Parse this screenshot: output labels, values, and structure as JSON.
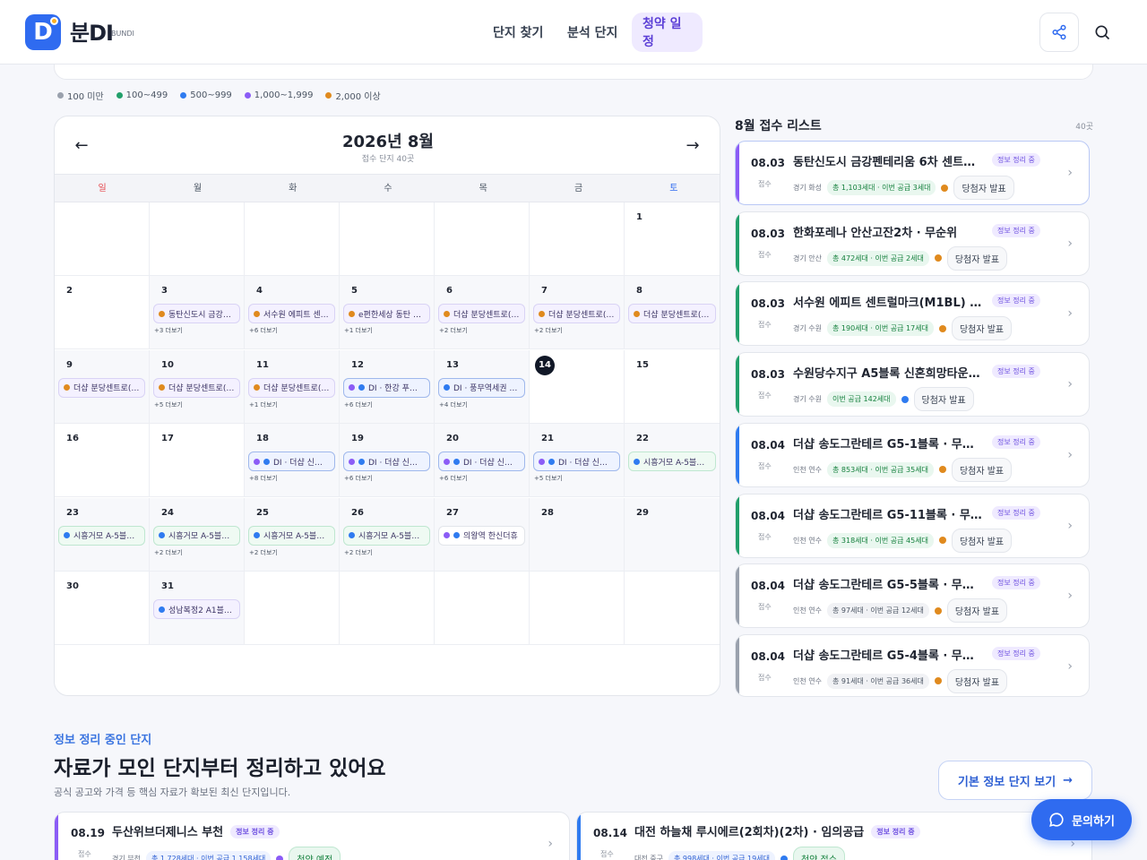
{
  "brand": {
    "name": "분DI",
    "sub": "BUNDI"
  },
  "nav": [
    {
      "label": "단지 찾기"
    },
    {
      "label": "분석 단지"
    },
    {
      "label": "청약 일정",
      "active": true
    }
  ],
  "legend": [
    {
      "label": "100 미만",
      "color": "#9aa1ad"
    },
    {
      "label": "100~499",
      "color": "#22a06b"
    },
    {
      "label": "500~999",
      "color": "#2f7bf0"
    },
    {
      "label": "1,000~1,999",
      "color": "#8b5cf6"
    },
    {
      "label": "2,000 이상",
      "color": "#e08a1e"
    }
  ],
  "calendar": {
    "title": "2026년 8월",
    "subtitle": "접수 단지 40곳",
    "weekdays": [
      "일",
      "월",
      "화",
      "수",
      "목",
      "금",
      "토"
    ],
    "cells": [
      {
        "day": "",
        "dim": false
      },
      {
        "day": "",
        "dim": false
      },
      {
        "day": "",
        "dim": false
      },
      {
        "day": "",
        "dim": false
      },
      {
        "day": "",
        "dim": false
      },
      {
        "day": "",
        "dim": false
      },
      {
        "day": "1",
        "dim": false
      },
      {
        "day": "2",
        "dim": false
      },
      {
        "day": "3",
        "dim": true,
        "ev": "동탄신도시 금강…",
        "cls": "",
        "dots": [
          "#e08a1e"
        ],
        "more": "+3 더보기"
      },
      {
        "day": "4",
        "dim": true,
        "ev": "서수원 에피트 센…",
        "cls": "",
        "dots": [
          "#e08a1e"
        ],
        "more": "+6 더보기"
      },
      {
        "day": "5",
        "dim": true,
        "ev": "e편한세상 동탄 …",
        "cls": "",
        "dots": [
          "#e08a1e"
        ],
        "more": "+1 더보기"
      },
      {
        "day": "6",
        "dim": true,
        "ev": "더샵 분당센트로(…",
        "cls": "",
        "dots": [
          "#e08a1e"
        ],
        "more": "+2 더보기"
      },
      {
        "day": "7",
        "dim": true,
        "ev": "더샵 분당센트로(…",
        "cls": "",
        "dots": [
          "#e08a1e"
        ],
        "more": "+2 더보기"
      },
      {
        "day": "8",
        "dim": true,
        "ev": "더샵 분당센트로(…",
        "cls": "",
        "dots": [
          "#e08a1e"
        ]
      },
      {
        "day": "9",
        "dim": true,
        "ev": "더샵 분당센트로(…",
        "cls": "",
        "dots": [
          "#e08a1e"
        ]
      },
      {
        "day": "10",
        "dim": true,
        "ev": "더샵 분당센트로(…",
        "cls": "",
        "dots": [
          "#e08a1e"
        ],
        "more": "+5 더보기"
      },
      {
        "day": "11",
        "dim": true,
        "ev": "더샵 분당센트로(…",
        "cls": "",
        "dots": [
          "#e08a1e"
        ],
        "more": "+1 더보기"
      },
      {
        "day": "12",
        "dim": true,
        "ev": "DI · 한강 푸르…",
        "cls": "blue",
        "dots": [
          "#8b5cf6",
          "#2f7bf0"
        ],
        "more": "+6 더보기"
      },
      {
        "day": "13",
        "dim": true,
        "ev": "DI · 풍무역세권 …",
        "cls": "blue",
        "dots": [
          "#2f7bf0"
        ],
        "more": "+4 더보기"
      },
      {
        "day": "14",
        "dim": false,
        "today": true
      },
      {
        "day": "15",
        "dim": false
      },
      {
        "day": "16",
        "dim": false
      },
      {
        "day": "17",
        "dim": false
      },
      {
        "day": "18",
        "dim": true,
        "ev": "DI · 더샵 신길…",
        "cls": "blue",
        "dots": [
          "#8b5cf6",
          "#2f7bf0"
        ],
        "more": "+8 더보기"
      },
      {
        "day": "19",
        "dim": true,
        "ev": "DI · 더샵 신길…",
        "cls": "blue",
        "dots": [
          "#8b5cf6",
          "#2f7bf0"
        ],
        "more": "+6 더보기"
      },
      {
        "day": "20",
        "dim": true,
        "ev": "DI · 더샵 신길…",
        "cls": "blue",
        "dots": [
          "#8b5cf6",
          "#2f7bf0"
        ],
        "more": "+6 더보기"
      },
      {
        "day": "21",
        "dim": true,
        "ev": "DI · 더샵 신길…",
        "cls": "blue",
        "dots": [
          "#8b5cf6",
          "#2f7bf0"
        ],
        "more": "+5 더보기"
      },
      {
        "day": "22",
        "dim": true,
        "ev": "시흥거모 A-5블…",
        "cls": "green",
        "dots": [
          "#2f7bf0"
        ]
      },
      {
        "day": "23",
        "dim": true,
        "ev": "시흥거모 A-5블…",
        "cls": "green",
        "dots": [
          "#2f7bf0"
        ]
      },
      {
        "day": "24",
        "dim": true,
        "ev": "시흥거모 A-5블…",
        "cls": "green",
        "dots": [
          "#2f7bf0"
        ],
        "more": "+2 더보기"
      },
      {
        "day": "25",
        "dim": true,
        "ev": "시흥거모 A-5블…",
        "cls": "green",
        "dots": [
          "#2f7bf0"
        ],
        "more": "+2 더보기"
      },
      {
        "day": "26",
        "dim": true,
        "ev": "시흥거모 A-5블…",
        "cls": "green",
        "dots": [
          "#2f7bf0"
        ],
        "more": "+2 더보기"
      },
      {
        "day": "27",
        "dim": true,
        "ev": "의왕역 한신더휴",
        "cls": "gray",
        "dots": [
          "#8b5cf6",
          "#2f7bf0"
        ]
      },
      {
        "day": "28",
        "dim": true
      },
      {
        "day": "29",
        "dim": true
      },
      {
        "day": "30",
        "dim": false
      },
      {
        "day": "31",
        "dim": true,
        "ev": "성남복정2 A1블…",
        "cls": "",
        "dots": [
          "#2f7bf0"
        ]
      },
      {
        "day": "",
        "dim": false
      },
      {
        "day": "",
        "dim": false
      },
      {
        "day": "",
        "dim": false
      },
      {
        "day": "",
        "dim": false
      },
      {
        "day": "",
        "dim": false
      }
    ]
  },
  "list": {
    "title": "8월 접수 리스트",
    "count": "40곳",
    "items": [
      {
        "date": "08.03",
        "label": "접수",
        "name": "동탄신도시 금강펜테리움 6차 센트…",
        "badge": "정보 정리 중",
        "region": "경기 화성",
        "pill": "총 1,103세대 · 이번 공급 3세대",
        "pillType": "green",
        "dot": "#e08a1e",
        "action": "당첨자 발표",
        "bar": "#8b5cf6",
        "sel": true
      },
      {
        "date": "08.03",
        "label": "접수",
        "name": "한화포레나 안산고잔2차 · 무순위",
        "badge": "정보 정리 중",
        "region": "경기 안산",
        "pill": "총 472세대 · 이번 공급 2세대",
        "pillType": "green",
        "dot": "#e08a1e",
        "action": "당첨자 발표",
        "bar": "#22a06b"
      },
      {
        "date": "08.03",
        "label": "접수",
        "name": "서수원 에피트 센트럴마크(M1BL) …",
        "badge": "정보 정리 중",
        "region": "경기 수원",
        "pill": "총 190세대 · 이번 공급 17세대",
        "pillType": "green",
        "dot": "#e08a1e",
        "action": "당첨자 발표",
        "bar": "#22a06b"
      },
      {
        "date": "08.03",
        "label": "접수",
        "name": "수원당수지구 A5블록 신혼희망타운…",
        "badge": "정보 정리 중",
        "region": "경기 수원",
        "pill": "이번 공급 142세대",
        "pillType": "green",
        "dot": "#2f7bf0",
        "action": "당첨자 발표",
        "bar": "#22a06b"
      },
      {
        "date": "08.04",
        "label": "접수",
        "name": "더샵 송도그란테르 G5-1블록 · 무…",
        "badge": "정보 정리 중",
        "region": "인천 연수",
        "pill": "총 853세대 · 이번 공급 35세대",
        "pillType": "green",
        "dot": "#e08a1e",
        "action": "당첨자 발표",
        "bar": "#2f7bf0"
      },
      {
        "date": "08.04",
        "label": "접수",
        "name": "더샵 송도그란테르 G5-11블록 · 무…",
        "badge": "정보 정리 중",
        "region": "인천 연수",
        "pill": "총 318세대 · 이번 공급 45세대",
        "pillType": "green",
        "dot": "#e08a1e",
        "action": "당첨자 발표",
        "bar": "#22a06b"
      },
      {
        "date": "08.04",
        "label": "접수",
        "name": "더샵 송도그란테르 G5-5블록 · 무…",
        "badge": "정보 정리 중",
        "region": "인천 연수",
        "pill": "총 97세대 · 이번 공급 12세대",
        "pillType": "gray",
        "dot": "#e08a1e",
        "action": "당첨자 발표",
        "bar": "#9aa1ad"
      },
      {
        "date": "08.04",
        "label": "접수",
        "name": "더샵 송도그란테르 G5-4블록 · 무…",
        "badge": "정보 정리 중",
        "region": "인천 연수",
        "pill": "총 91세대 · 이번 공급 36세대",
        "pillType": "gray",
        "dot": "#e08a1e",
        "action": "당첨자 발표",
        "bar": "#9aa1ad"
      }
    ]
  },
  "section": {
    "tag": "정보 정리 중인 단지",
    "title": "자료가 모인 단지부터 정리하고 있어요",
    "desc": "공식 공고와 가격 등 핵심 자료가 확보된 최신 단지입니다.",
    "button": "기본 정보 단지 보기",
    "cards": [
      {
        "date": "08.19",
        "label": "접수",
        "name": "두산위브더제니스 부천",
        "badge": "정보 정리 중",
        "region": "경기 부천",
        "pill": "총 1,728세대 · 이번 공급 1,158세대",
        "action": "청약 예정",
        "bar": "#8b5cf6"
      },
      {
        "date": "08.14",
        "label": "접수",
        "name": "대전 하늘채 루시에르(2회차)(2차) · 임의공급",
        "badge": "정보 정리 중",
        "region": "대전 중구",
        "pill": "총 998세대 · 이번 공급 19세대",
        "action": "청약 접수",
        "bar": "#2f7bf0"
      }
    ]
  },
  "fab": {
    "label": "문의하기"
  }
}
